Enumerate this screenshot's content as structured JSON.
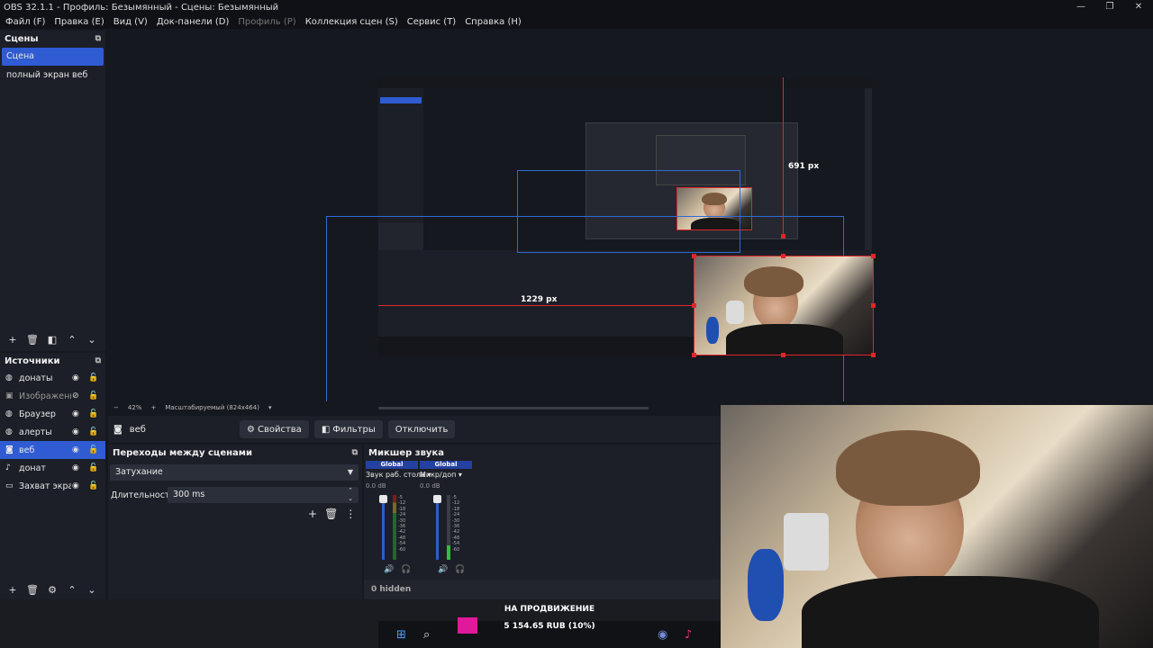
{
  "window": {
    "title": "OBS 32.1.1 - Профиль: Безымянный - Сцены: Безымянный",
    "controls": [
      "—",
      "❐",
      "✕"
    ]
  },
  "menu": [
    {
      "label": "Файл (F)",
      "disabled": false
    },
    {
      "label": "Правка (E)",
      "disabled": false
    },
    {
      "label": "Вид (V)",
      "disabled": false
    },
    {
      "label": "Док-панели (D)",
      "disabled": false
    },
    {
      "label": "Профиль (P)",
      "disabled": true
    },
    {
      "label": "Коллекция сцен (S)",
      "disabled": false
    },
    {
      "label": "Сервис (T)",
      "disabled": false
    },
    {
      "label": "Справка (H)",
      "disabled": false
    }
  ],
  "scenes": {
    "title": "Сцены",
    "items": [
      "Сцена",
      "полный экран веб"
    ],
    "active_index": 0
  },
  "sources": {
    "title": "Источники",
    "items": [
      {
        "label": "донаты",
        "icon": "browser-icon",
        "muted": false
      },
      {
        "label": "Изображение",
        "icon": "image-icon",
        "muted": true
      },
      {
        "label": "Браузер",
        "icon": "browser-icon",
        "muted": false
      },
      {
        "label": "алерты",
        "icon": "browser-icon",
        "muted": false
      },
      {
        "label": "веб",
        "icon": "camera-icon",
        "muted": false,
        "active": true
      },
      {
        "label": "донат",
        "icon": "audio-icon",
        "muted": false
      },
      {
        "label": "Захват экрана",
        "icon": "monitor-icon",
        "muted": false
      }
    ]
  },
  "preview": {
    "measure_height": "691 px",
    "measure_width": "1229 px",
    "zoom": "42%",
    "scale_mode": "Масштабируемый (824x464)"
  },
  "context_bar": {
    "source_name": "веб",
    "properties_label": "Свойства",
    "filters_label": "Фильтры",
    "disable_label": "Отключить"
  },
  "transitions": {
    "title": "Переходы между сценами",
    "type": "Затухание",
    "duration_label": "Длительность",
    "duration": "300 ms"
  },
  "mixer": {
    "title": "Микшер звука",
    "channels": [
      {
        "global": "Global",
        "name": "Звук раб. стола",
        "db": "0.0 dB"
      },
      {
        "global": "Global",
        "name": "Микр/доп",
        "db": "0.0 dB"
      }
    ],
    "scale": [
      "-5",
      "-12",
      "-18",
      "-24",
      "-30",
      "-36",
      "-42",
      "-48",
      "-54",
      "-60"
    ],
    "hidden": "0 hidden"
  },
  "overlay": {
    "promo_title": "НА ПРОДВИЖЕНИЕ",
    "promo_amount": "5 154.65 RUB (10%)"
  },
  "colors": {
    "accent": "#2f5bd3",
    "selection": "#e0252b",
    "guide": "#2d6bd6"
  }
}
